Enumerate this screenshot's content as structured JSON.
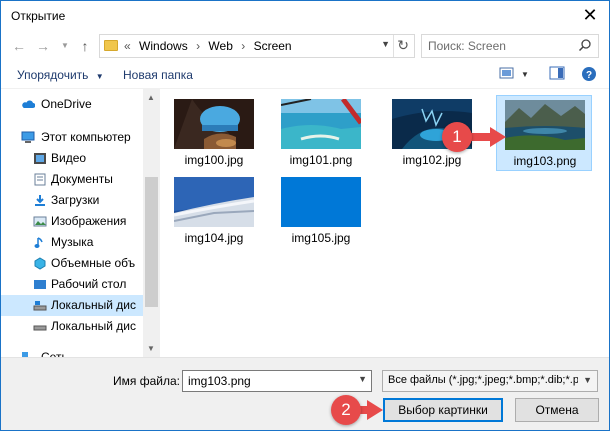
{
  "window": {
    "title": "Открытие"
  },
  "nav": {
    "path": [
      "Windows",
      "Web",
      "Screen"
    ],
    "search_placeholder": "Поиск: Screen"
  },
  "toolbar": {
    "organize_label": "Упорядочить",
    "new_folder_label": "Новая папка"
  },
  "sidebar": {
    "items": [
      {
        "label": "OneDrive",
        "icon": "cloud-icon"
      },
      {
        "label": "Этот компьютер",
        "icon": "computer-icon"
      },
      {
        "label": "Видео",
        "icon": "video-icon"
      },
      {
        "label": "Документы",
        "icon": "documents-icon"
      },
      {
        "label": "Загрузки",
        "icon": "downloads-icon"
      },
      {
        "label": "Изображения",
        "icon": "images-icon"
      },
      {
        "label": "Музыка",
        "icon": "music-icon"
      },
      {
        "label": "Объемные объ",
        "icon": "3d-objects-icon"
      },
      {
        "label": "Рабочий стол",
        "icon": "desktop-icon"
      },
      {
        "label": "Локальный дис",
        "icon": "local-disk-icon"
      },
      {
        "label": "Локальный дис",
        "icon": "local-disk-icon"
      },
      {
        "label": "Сеть",
        "icon": "network-icon"
      }
    ],
    "selected_index": 9
  },
  "files": [
    {
      "name": "img100.jpg"
    },
    {
      "name": "img101.png"
    },
    {
      "name": "img102.jpg"
    },
    {
      "name": "img103.png",
      "selected": true
    },
    {
      "name": "img104.jpg"
    },
    {
      "name": "img105.jpg"
    }
  ],
  "footer": {
    "filename_label": "Имя файла:",
    "filename_value": "img103.png",
    "filter_value": "Все файлы (*.jpg;*.jpeg;*.bmp;*.dib;*.p",
    "open_label": "Выбор картинки",
    "cancel_label": "Отмена"
  },
  "annotations": {
    "badge1": "1",
    "badge2": "2"
  },
  "colors": {
    "accent": "#0078d7",
    "badge": "#e74a4a",
    "selection": "#cce8ff"
  }
}
